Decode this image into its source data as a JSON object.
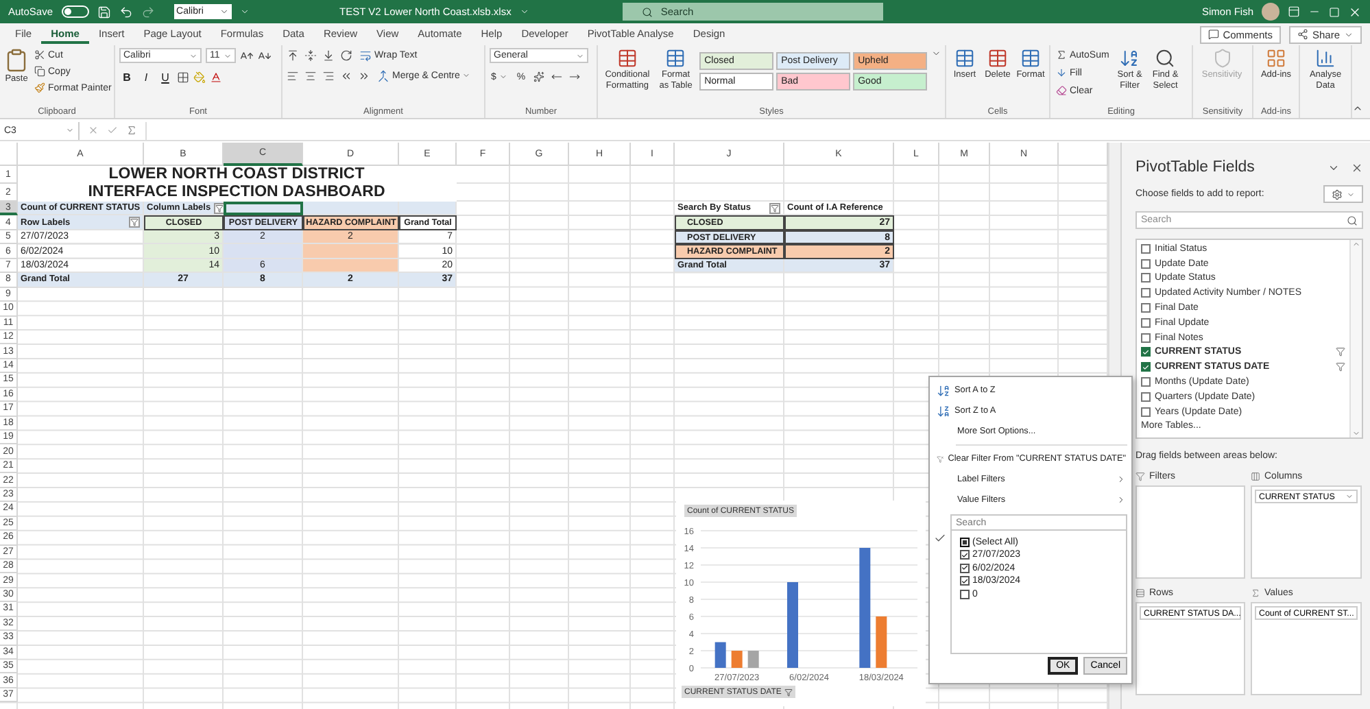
{
  "title_bar": {
    "autosave_label": "AutoSave",
    "autosave_on": false,
    "quick_font": "Calibri",
    "file_name": "TEST V2 Lower North Coast.xlsb.xlsx",
    "search_placeholder": "Search",
    "user_name": "Simon Fish"
  },
  "menu_tabs": [
    {
      "label": "File",
      "selected": false
    },
    {
      "label": "Home",
      "selected": true
    },
    {
      "label": "Insert",
      "selected": false
    },
    {
      "label": "Page Layout",
      "selected": false
    },
    {
      "label": "Formulas",
      "selected": false
    },
    {
      "label": "Data",
      "selected": false
    },
    {
      "label": "Review",
      "selected": false
    },
    {
      "label": "View",
      "selected": false
    },
    {
      "label": "Automate",
      "selected": false
    },
    {
      "label": "Help",
      "selected": false
    },
    {
      "label": "Developer",
      "selected": false
    },
    {
      "label": "PivotTable Analyse",
      "selected": false
    },
    {
      "label": "Design",
      "selected": false
    }
  ],
  "share_buttons": [
    "Comments",
    "Share"
  ],
  "ribbon": {
    "clipboard": {
      "label": "Clipboard",
      "paste": "Paste",
      "cut": "Cut",
      "copy": "Copy",
      "format_painter": "Format Painter"
    },
    "font": {
      "label": "Font",
      "font_name": "Calibri",
      "font_size": "11",
      "bold": "B",
      "italic": "I",
      "underline": "U"
    },
    "alignment": {
      "label": "Alignment",
      "wrap_text": "Wrap Text",
      "merge": "Merge & Centre"
    },
    "number": {
      "label": "Number",
      "format": "General",
      "currency": "$",
      "percent": "%"
    },
    "styles": {
      "label": "Styles",
      "conditional": "Conditional Formatting",
      "format_table": "Format as Table",
      "cell_styles": [
        {
          "label": "Closed",
          "color": "#e2efda"
        },
        {
          "label": "Post Delivery",
          "color": "#ddebf7"
        },
        {
          "label": "Upheld",
          "color": "#f4b084"
        },
        {
          "label": "Normal",
          "color": "#ffffff"
        },
        {
          "label": "Bad",
          "color": "#ffc7ce"
        },
        {
          "label": "Good",
          "color": "#c6efce"
        }
      ]
    },
    "cells": {
      "label": "Cells",
      "buttons": [
        "Insert",
        "Delete",
        "Format"
      ]
    },
    "editing": {
      "label": "Editing",
      "autosum": "AutoSum",
      "fill": "Fill",
      "clear": "Clear",
      "sort_filter": "Sort & Filter",
      "find_select": "Find & Select"
    },
    "sensitivity": {
      "label": "Sensitivity",
      "button": "Sensitivity",
      "disabled": true
    },
    "addins": {
      "label": "Add-ins",
      "button": "Add-ins"
    },
    "analyse": {
      "button": "Analyse Data"
    }
  },
  "formula_bar": {
    "name_box": "C3"
  },
  "sheet": {
    "columns": [
      "A",
      "B",
      "C",
      "D",
      "E",
      "F",
      "G",
      "H",
      "I",
      "J",
      "K",
      "L",
      "M",
      "N"
    ],
    "rows": [
      "1",
      "2",
      "3",
      "4",
      "5",
      "6",
      "7",
      "8",
      "9",
      "10",
      "11",
      "12",
      "13",
      "14",
      "15",
      "16",
      "17",
      "18",
      "19",
      "20",
      "21",
      "22",
      "23",
      "24",
      "25",
      "26",
      "27",
      "28",
      "29",
      "30",
      "31",
      "32",
      "33",
      "34",
      "35",
      "36",
      "37"
    ],
    "title": "LOWER NORTH COAST DISTRICT",
    "subtitle": "INTERFACE INSPECTION DASHBOARD",
    "pivot": {
      "value_field": "Count of CURRENT STATUS",
      "column_labels": "Column Labels",
      "row_labels": "Row Labels",
      "columns": [
        {
          "label": "CLOSED",
          "color": "#e2efda"
        },
        {
          "label": "POST DELIVERY",
          "color": "#d9e1f2"
        },
        {
          "label": "HAZARD COMPLAINT",
          "color": "#f8cbad"
        }
      ],
      "grand_total_column": "Grand Total",
      "rows": [
        {
          "label": "27/07/2023",
          "cells": [
            {
              "kind": "value",
              "value": "3"
            },
            {
              "kind": "value",
              "value": "2"
            },
            {
              "kind": "value",
              "value": "2"
            }
          ],
          "total": "7"
        },
        {
          "label": "6/02/2024",
          "cells": [
            {
              "kind": "value",
              "value": "10"
            },
            {
              "kind": "empty"
            },
            {
              "kind": "empty"
            }
          ],
          "total": "10"
        },
        {
          "label": "18/03/2024",
          "cells": [
            {
              "kind": "value",
              "value": "14"
            },
            {
              "kind": "value",
              "value": "6"
            },
            {
              "kind": "empty"
            }
          ],
          "total": "20"
        }
      ],
      "total_row": {
        "label": "Grand Total",
        "values": [
          "27",
          "8",
          "2"
        ],
        "total": "37"
      }
    },
    "status_pivot": {
      "header": "Search By Status",
      "value_header": "Count of I.A Reference",
      "rows": [
        {
          "label": "CLOSED",
          "value": "27",
          "color": "#e2efda"
        },
        {
          "label": "POST DELIVERY",
          "value": "8",
          "color": "#dde7f3"
        },
        {
          "label": "HAZARD COMPLAINT",
          "value": "2",
          "color": "#f8cbad"
        }
      ],
      "total_row": {
        "label": "Grand Total",
        "value": "37"
      }
    }
  },
  "pivot_chart": {
    "value_field": "Count of CURRENT STATUS",
    "axis_field": "CURRENT STATUS DATE",
    "chart_data": {
      "type": "bar",
      "grid": true,
      "categories": [
        "27/07/2023",
        "6/02/2024",
        "18/03/2024"
      ],
      "series": [
        {
          "color": "#4472c4",
          "values": [
            3,
            10,
            14
          ]
        },
        {
          "color": "#ed7d31",
          "values": [
            2,
            null,
            6
          ]
        },
        {
          "color": "#a5a5a5",
          "values": [
            2,
            null,
            null
          ]
        }
      ],
      "ylim": [
        0,
        16
      ],
      "yticks": [
        0,
        2,
        4,
        6,
        8,
        10,
        12,
        14,
        16
      ]
    }
  },
  "filter_menu": {
    "items": [
      {
        "kind": "sort_asc",
        "label": "Sort A to Z"
      },
      {
        "kind": "sort_desc",
        "label": "Sort Z to A"
      },
      {
        "kind": "plain",
        "label": "More Sort Options..."
      },
      {
        "kind": "clear",
        "label": "Clear Filter From \"CURRENT STATUS DATE\""
      },
      {
        "kind": "submenu",
        "label": "Label Filters"
      },
      {
        "kind": "submenu",
        "label": "Value Filters"
      }
    ],
    "search_placeholder": "Search",
    "values": [
      {
        "label": "(Select All)",
        "checked": false,
        "partial": true
      },
      {
        "label": "27/07/2023",
        "checked": true,
        "partial": false
      },
      {
        "label": "6/02/2024",
        "checked": true,
        "partial": false
      },
      {
        "label": "18/03/2024",
        "checked": true,
        "partial": false
      },
      {
        "label": "0",
        "checked": false,
        "partial": false
      }
    ],
    "buttons": [
      "OK",
      "Cancel"
    ]
  },
  "pivot_pane": {
    "title": "PivotTable Fields",
    "hint": "Choose fields to add to report:",
    "search_placeholder": "Search",
    "fields": [
      {
        "label": "Initial Status",
        "checked": false,
        "filtered": false
      },
      {
        "label": "Update Date",
        "checked": false,
        "filtered": false
      },
      {
        "label": "Update Status",
        "checked": false,
        "filtered": false
      },
      {
        "label": "Updated Activity Number / NOTES",
        "checked": false,
        "filtered": false
      },
      {
        "label": "Final Date",
        "checked": false,
        "filtered": false
      },
      {
        "label": "Final Update",
        "checked": false,
        "filtered": false
      },
      {
        "label": "Final Notes",
        "checked": false,
        "filtered": false
      },
      {
        "label": "CURRENT STATUS",
        "checked": true,
        "filtered": true
      },
      {
        "label": "CURRENT STATUS DATE",
        "checked": true,
        "filtered": true
      },
      {
        "label": "Months (Update Date)",
        "checked": false,
        "filtered": false
      },
      {
        "label": "Quarters (Update Date)",
        "checked": false,
        "filtered": false
      },
      {
        "label": "Years (Update Date)",
        "checked": false,
        "filtered": false
      }
    ],
    "more_tables": "More Tables...",
    "areas_hint": "Drag fields between areas below:",
    "areas": [
      {
        "kind": "filters",
        "label": "Filters"
      },
      {
        "kind": "columns",
        "label": "Columns",
        "fields": [
          "CURRENT STATUS"
        ]
      },
      {
        "kind": "rows",
        "label": "Rows",
        "fields": [
          "CURRENT STATUS DA..."
        ]
      },
      {
        "kind": "values",
        "label": "Values",
        "fields": [
          "Count of CURRENT ST..."
        ]
      }
    ]
  }
}
